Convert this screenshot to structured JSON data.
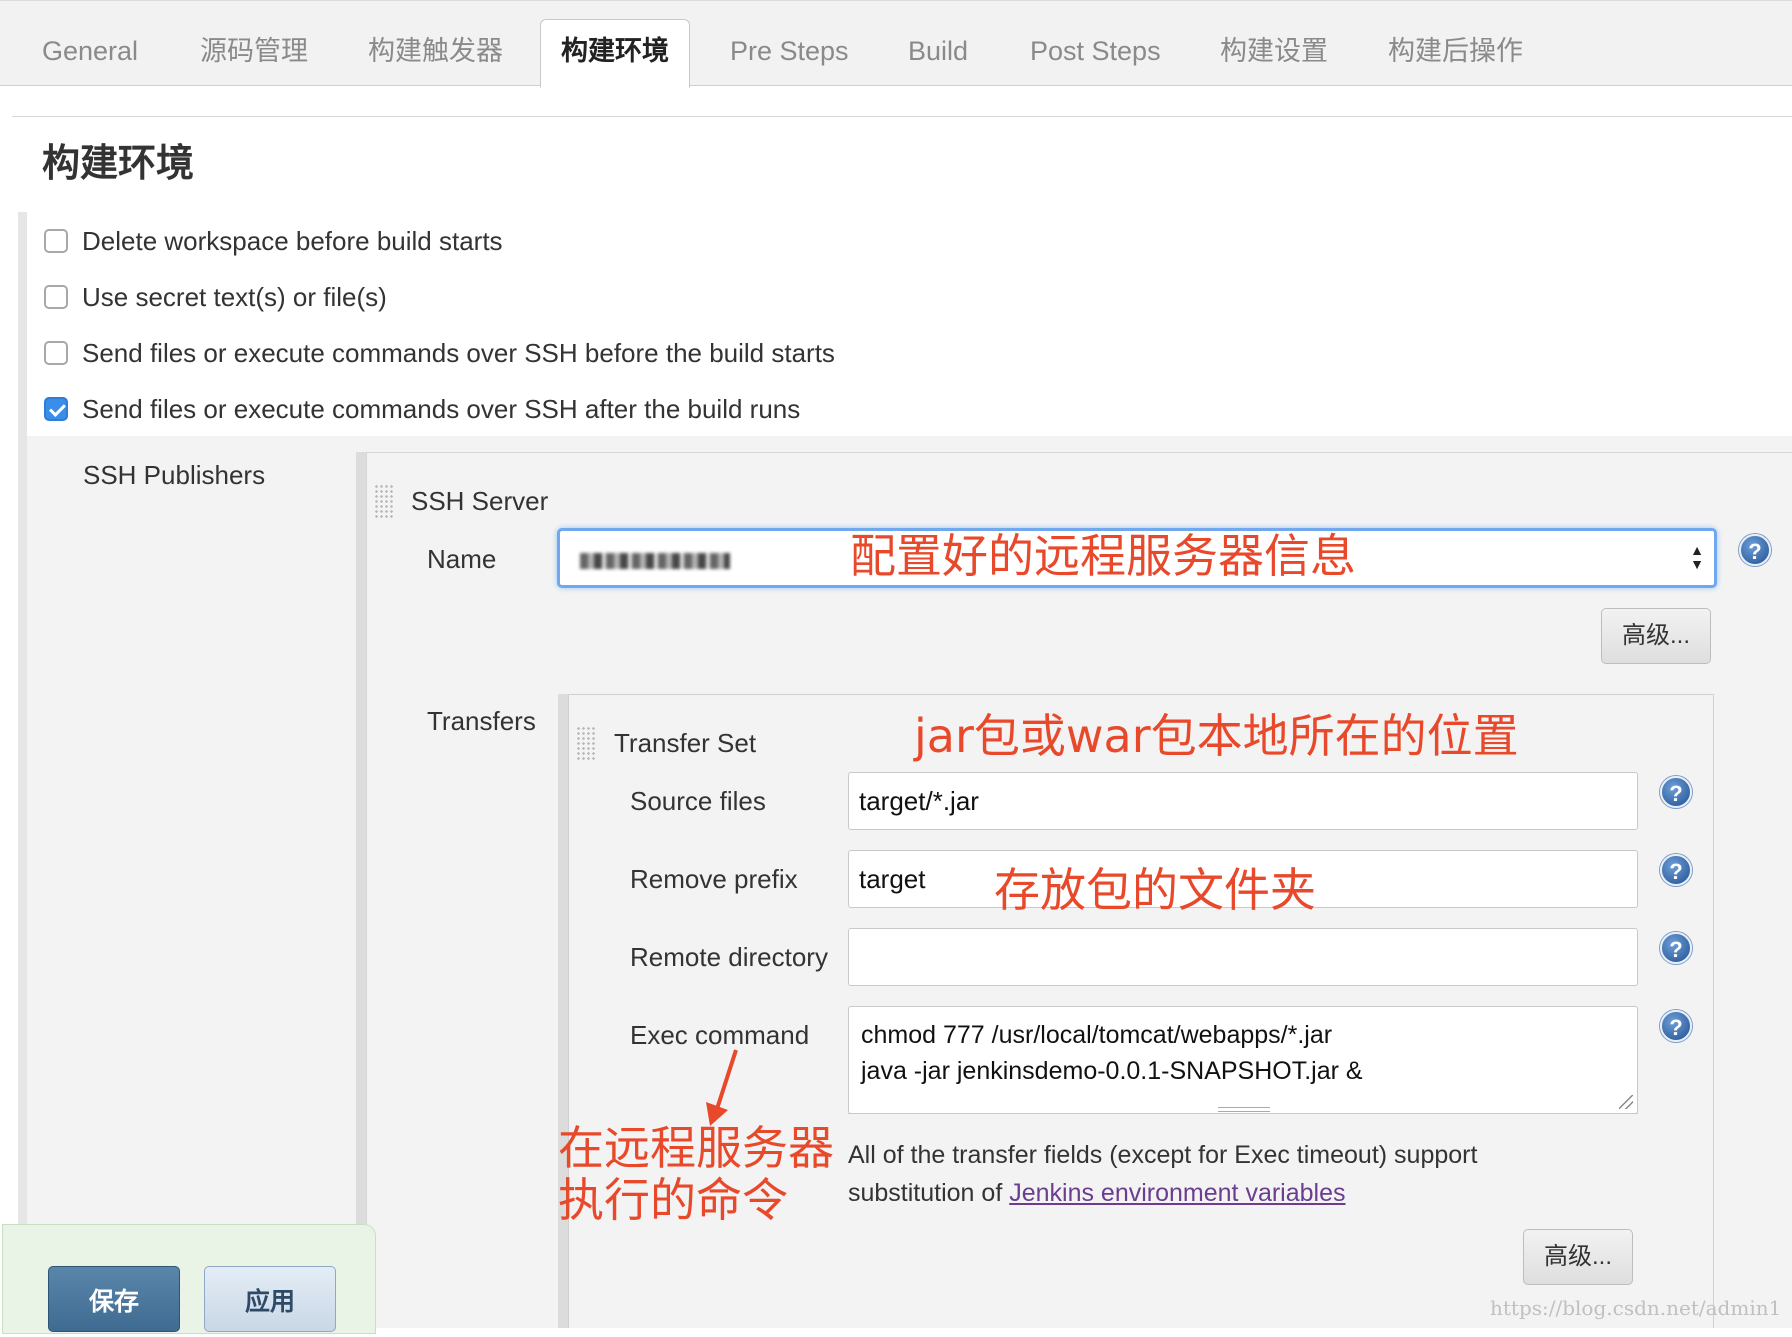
{
  "tabs": [
    {
      "label": "General",
      "active": false
    },
    {
      "label": "源码管理",
      "active": false
    },
    {
      "label": "构建触发器",
      "active": false
    },
    {
      "label": "构建环境",
      "active": true
    },
    {
      "label": "Pre Steps",
      "active": false
    },
    {
      "label": "Build",
      "active": false
    },
    {
      "label": "Post Steps",
      "active": false
    },
    {
      "label": "构建设置",
      "active": false
    },
    {
      "label": "构建后操作",
      "active": false
    }
  ],
  "section": {
    "title": "构建环境"
  },
  "checkboxes": [
    {
      "label": "Delete workspace before build starts",
      "checked": false
    },
    {
      "label": "Use secret text(s) or file(s)",
      "checked": false
    },
    {
      "label": "Send files or execute commands over SSH before the build starts",
      "checked": false
    },
    {
      "label": "Send files or execute commands over SSH after the build runs",
      "checked": true
    }
  ],
  "ssh": {
    "publishers_label": "SSH Publishers",
    "server_label": "SSH Server",
    "name_label": "Name",
    "advanced_label": "高级...",
    "transfers_label": "Transfers",
    "transfer_set_label": "Transfer Set",
    "source_files_label": "Source files",
    "source_files_value": "target/*.jar",
    "remove_prefix_label": "Remove prefix",
    "remove_prefix_value": "target",
    "remote_directory_label": "Remote directory",
    "remote_directory_value": "",
    "exec_command_label": "Exec command",
    "exec_command_lines": [
      "chmod 777 /usr/local/tomcat/webapps/*.jar",
      "java -jar jenkinsdemo-0.0.1-SNAPSHOT.jar &"
    ],
    "info_text": "All of the transfer fields (except for Exec timeout) support",
    "info_text2": "substitution of ",
    "info_link": "Jenkins environment variables",
    "advanced2_label": "高级..."
  },
  "buttons": {
    "save": "保存",
    "apply": "应用"
  },
  "annotations": {
    "server": "配置好的远程服务器信息",
    "jar": "jar包或war包本地所在的位置",
    "folder": "存放包的文件夹",
    "exec_line1": "在远程服务器",
    "exec_line2": "执行的命令"
  },
  "watermark": "https://blog.csdn.net/admin1",
  "colors": {
    "annotation": "#e8492b",
    "checkbox_checked": "#3b8ee8",
    "link": "#6a3d8f"
  }
}
